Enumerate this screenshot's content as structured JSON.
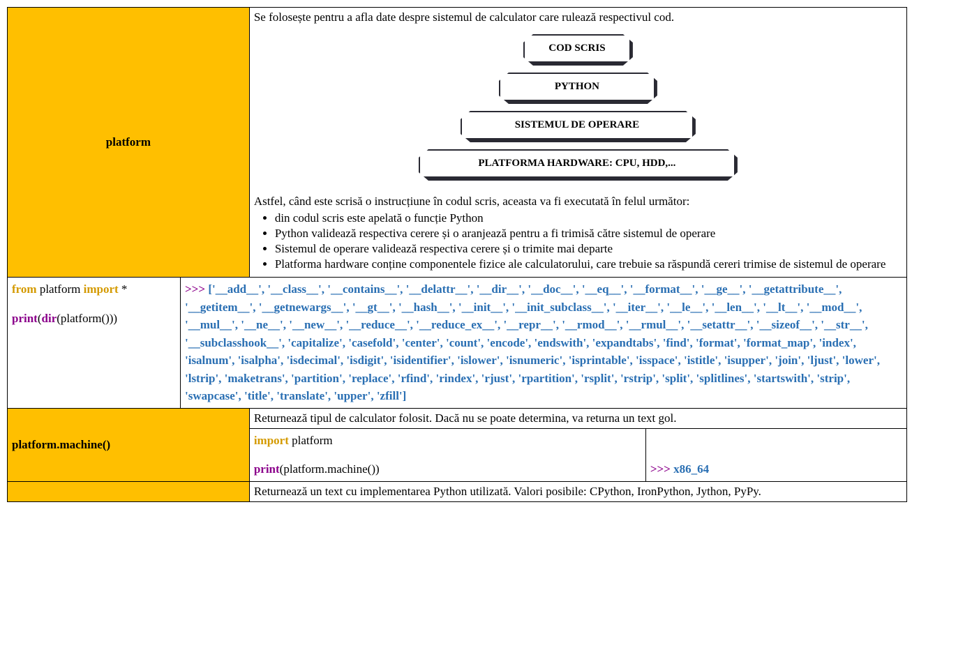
{
  "row1": {
    "title": "platform",
    "intro": "Se folosește pentru a afla date despre sistemul de calculator care rulează respectivul cod.",
    "pyramid": {
      "t1": "COD SCRIS",
      "t2": "PYTHON",
      "t3": "SISTEMUL DE OPERARE",
      "t4": "PLATFORMA HARDWARE: CPU, HDD,..."
    },
    "explain": "Astfel, când este scrisă o instrucțiune în codul scris, aceasta va fi executată în felul următor:",
    "bullets": [
      "din codul scris este apelată o funcție Python",
      "Python validează respectiva cerere și o aranjează pentru a fi trimisă către sistemul de operare",
      "Sistemul de operare validează respectiva cerere și o trimite mai departe",
      "Platforma hardware conține componentele fizice ale calculatorului, care trebuie sa răspundă cereri trimise de sistemul de operare"
    ]
  },
  "row2": {
    "code": {
      "from": "from",
      "platform": " platform ",
      "import": "import",
      "star": " *",
      "print": "print",
      "dir": "dir",
      "open": "(",
      "arg": "(platform()))"
    },
    "prompt": ">>> ",
    "out": "['__add__', '__class__', '__contains__', '__delattr__', '__dir__', '__doc__', '__eq__', '__format__', '__ge__', '__getattribute__', '__getitem__', '__getnewargs__', '__gt__', '__hash__', '__init__', '__init_subclass__', '__iter__', '__le__', '__len__', '__lt__', '__mod__', '__mul__', '__ne__', '__new__', '__reduce__', '__reduce_ex__', '__repr__', '__rmod__', '__rmul__', '__setattr__', '__sizeof__', '__str__', '__subclasshook__', 'capitalize', 'casefold', 'center', 'count', 'encode', 'endswith', 'expandtabs', 'find', 'format', 'format_map', 'index', 'isalnum', 'isalpha', 'isdecimal', 'isdigit', 'isidentifier', 'islower', 'isnumeric', 'isprintable', 'isspace', 'istitle', 'isupper', 'join', 'ljust', 'lower', 'lstrip', 'maketrans', 'partition', 'replace', 'rfind', 'rindex', 'rjust', 'rpartition', 'rsplit', 'rstrip', 'split', 'splitlines', 'startswith', 'strip', 'swapcase', 'title', 'translate', 'upper', 'zfill']"
  },
  "row3": {
    "title": "platform.machine()",
    "desc": "Returnează tipul de calculator folosit. Dacă nu se poate determina, va returna un text gol.",
    "code": {
      "import": "import",
      "platform": " platform",
      "print": "print",
      "call": "(platform.machine())"
    },
    "prompt": ">>> ",
    "out": "x86_64"
  },
  "row4": {
    "desc": "Returnează un text cu implementarea Python utilizată. Valori posibile: CPython, IronPython, Jython, PyPy."
  }
}
